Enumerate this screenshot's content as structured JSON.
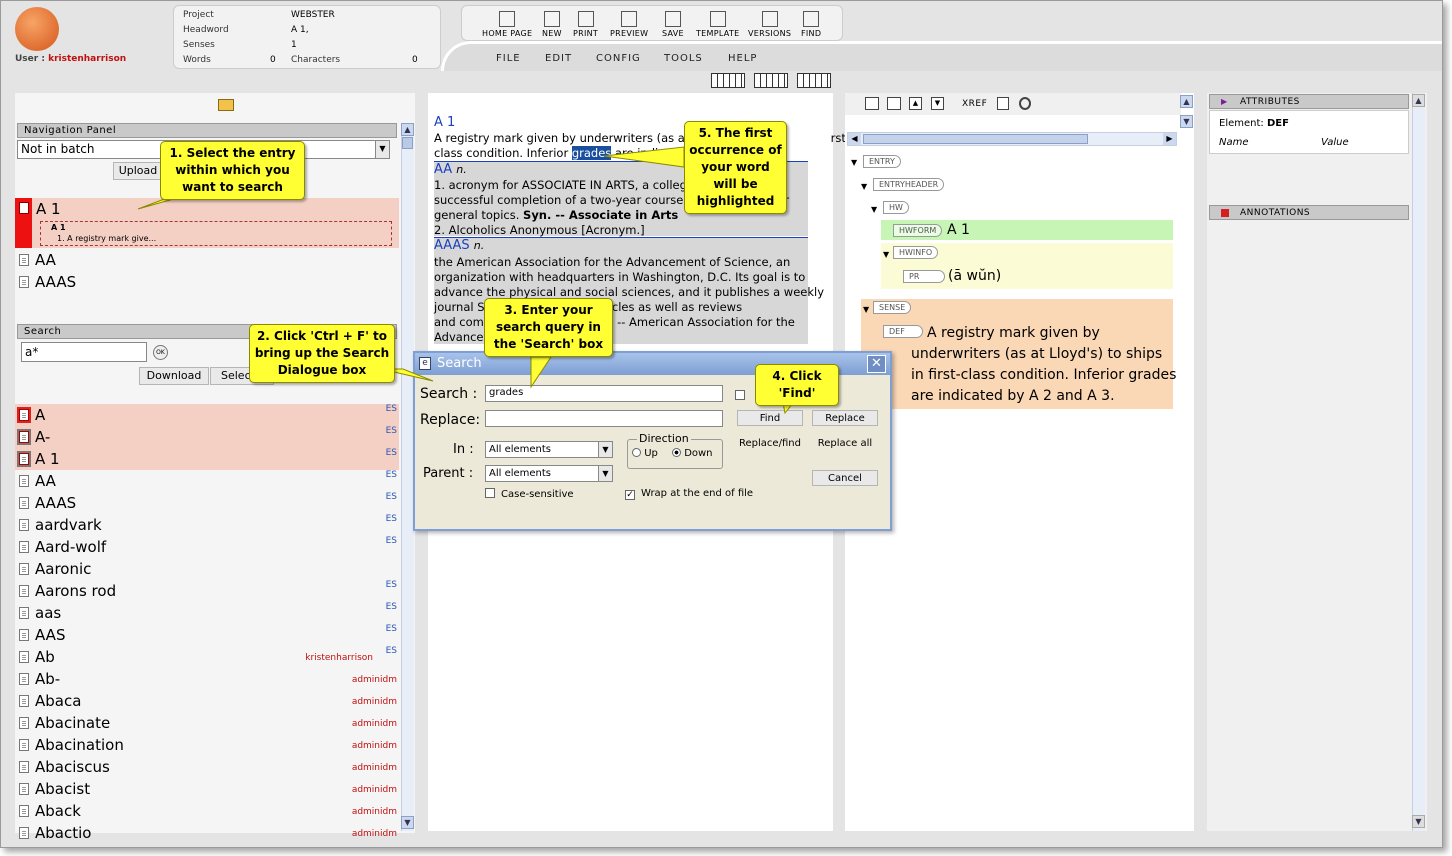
{
  "header": {
    "user_label": "User :",
    "user_name": "kristenharrison",
    "info": {
      "project_label": "Project",
      "project_value": "WEBSTER",
      "headword_label": "Headword",
      "headword_value": "A 1,",
      "senses_label": "Senses",
      "senses_value": "1",
      "words_label": "Words",
      "words_value": "0",
      "characters_label": "Characters",
      "characters_value": "0"
    },
    "toolbar": [
      "HOME PAGE",
      "NEW",
      "PRINT",
      "PREVIEW",
      "SAVE",
      "TEMPLATE",
      "VERSIONS",
      "FIND"
    ],
    "menu": [
      "FILE",
      "EDIT",
      "CONFIG",
      "TOOLS",
      "HELP"
    ]
  },
  "nav_panel": {
    "title": "Navigation Panel",
    "batch_select": "Not in batch",
    "upload_label": "Upload",
    "selected_entry": "A 1",
    "selected_sub_title": "A 1",
    "selected_sub_text": "1. A registry mark give...",
    "entries": [
      "AA",
      "AAAS"
    ]
  },
  "search_panel": {
    "title": "Search",
    "query": "a*",
    "ok_label": "OK",
    "download_label": "Download",
    "select_label": "Selec"
  },
  "results": [
    {
      "word": "A",
      "tag": "ES",
      "hl": true
    },
    {
      "word": "A-",
      "tag": "ES",
      "hl": true
    },
    {
      "word": "A 1",
      "tag": "ES",
      "hl": true
    },
    {
      "word": "AA",
      "tag": "ES"
    },
    {
      "word": "AAAS",
      "tag": "ES"
    },
    {
      "word": "aardvark",
      "tag": "ES"
    },
    {
      "word": "Aard-wolf",
      "tag": "ES"
    },
    {
      "word": "Aaronic",
      "tag": ""
    },
    {
      "word": "Aarons rod",
      "tag": "ES"
    },
    {
      "word": "aas",
      "tag": "ES"
    },
    {
      "word": "AAS",
      "tag": "ES"
    },
    {
      "word": "Ab",
      "tag": "ES",
      "owner": "kristenharrison"
    },
    {
      "word": "Ab-",
      "owner": "adminidm"
    },
    {
      "word": "Abaca",
      "owner": "adminidm"
    },
    {
      "word": "Abacinate",
      "owner": "adminidm"
    },
    {
      "word": "Abacination",
      "owner": "adminidm"
    },
    {
      "word": "Abaciscus",
      "owner": "adminidm"
    },
    {
      "word": "Abacist",
      "owner": "adminidm"
    },
    {
      "word": "Aback",
      "owner": "adminidm"
    },
    {
      "word": "Abactio",
      "owner": "adminidm"
    }
  ],
  "preview": {
    "e1_head": "A 1",
    "e1_l1": "A registry mark given by underwriters (as at Ll",
    "e1_l1b": "rst-",
    "e1_l2a": "class condition. Inferior",
    "e1_hl": "grades",
    "e1_l2c": "are indicated",
    "e2_head": "AA",
    "e2_pos": "n.",
    "e2_l1": "1. acronym for ASSOCIATE IN ARTS, a college d",
    "e2_l2": "successful completion of a two-year course of study in arts or",
    "e2_l3a": "general topics.",
    "e2_l3b": "Syn. -- Associate in Arts",
    "e2_l4": "2. Alcoholics Anonymous [Acronym.]",
    "e3_head": "AAAS",
    "e3_pos": "n.",
    "e3_l1": "the American Association for the Advancement of Science, an",
    "e3_l2": "organization with headquarters in Washington, D.C. Its goal is to",
    "e3_l3": "advance the physical and social sciences, and it publishes a weekly",
    "e3_l4a": "journal S",
    "e3_l4b": "earch articles as well as reviews",
    "e3_l5a": "and comm",
    "e3_l5b": "-- American Association for the",
    "e3_l6": "Advancem"
  },
  "xml_panel": {
    "xref_label": "XREF",
    "tags": {
      "entry": "ENTRY",
      "entryheader": "ENTRYHEADER",
      "hw": "HW",
      "hwform": "HWFORM",
      "hwinfo": "HWINFO",
      "pr": "PR",
      "sense": "SENSE",
      "def": "DEF"
    },
    "hwform_value": "A 1",
    "pr_value": "(ā wŭn)",
    "def_value": "A registry mark given by underwriters (as at Lloyd's) to ships in first-class condition. Inferior grades are indicated by A 2 and A 3."
  },
  "attributes": {
    "title": "Attributes",
    "element_label": "Element:",
    "element_value": "DEF",
    "col_name": "Name",
    "col_value": "Value",
    "annotations_title": "Annotations"
  },
  "dialog": {
    "title": "Search",
    "search_label": "Search :",
    "search_value": "grades",
    "replace_label": "Replace:",
    "replace_value": "",
    "in_label": "In :",
    "in_value": "All elements",
    "parent_label": "Parent :",
    "parent_value": "All elements",
    "direction_label": "Direction",
    "up_label": "Up",
    "down_label": "Down",
    "case_label": "Case-sensitive",
    "wrap_label": "Wrap at the end of file",
    "find_label": "Find",
    "replace_btn": "Replace",
    "replace_find_btn": "Replace/find",
    "replace_all_btn": "Replace all",
    "cancel_btn": "Cancel"
  },
  "callouts": {
    "c1": "1. Select the entry within which you want to search",
    "c2": "2. Click 'Ctrl + F' to bring up the Search Dialogue box",
    "c3": "3. Enter your search query in the 'Search' box",
    "c4": "4. Click 'Find'",
    "c5": "5. The first occurrence of your word will be highlighted"
  },
  "colors": {
    "accent_blue": "#1a3fbf",
    "callout_yellow": "#ffff33",
    "highlight_row": "#f4cfc4",
    "sense_bg": "#fad7b5",
    "hwform_bg": "#c6f5b5",
    "hwinfo_bg": "#fbfbd6"
  }
}
